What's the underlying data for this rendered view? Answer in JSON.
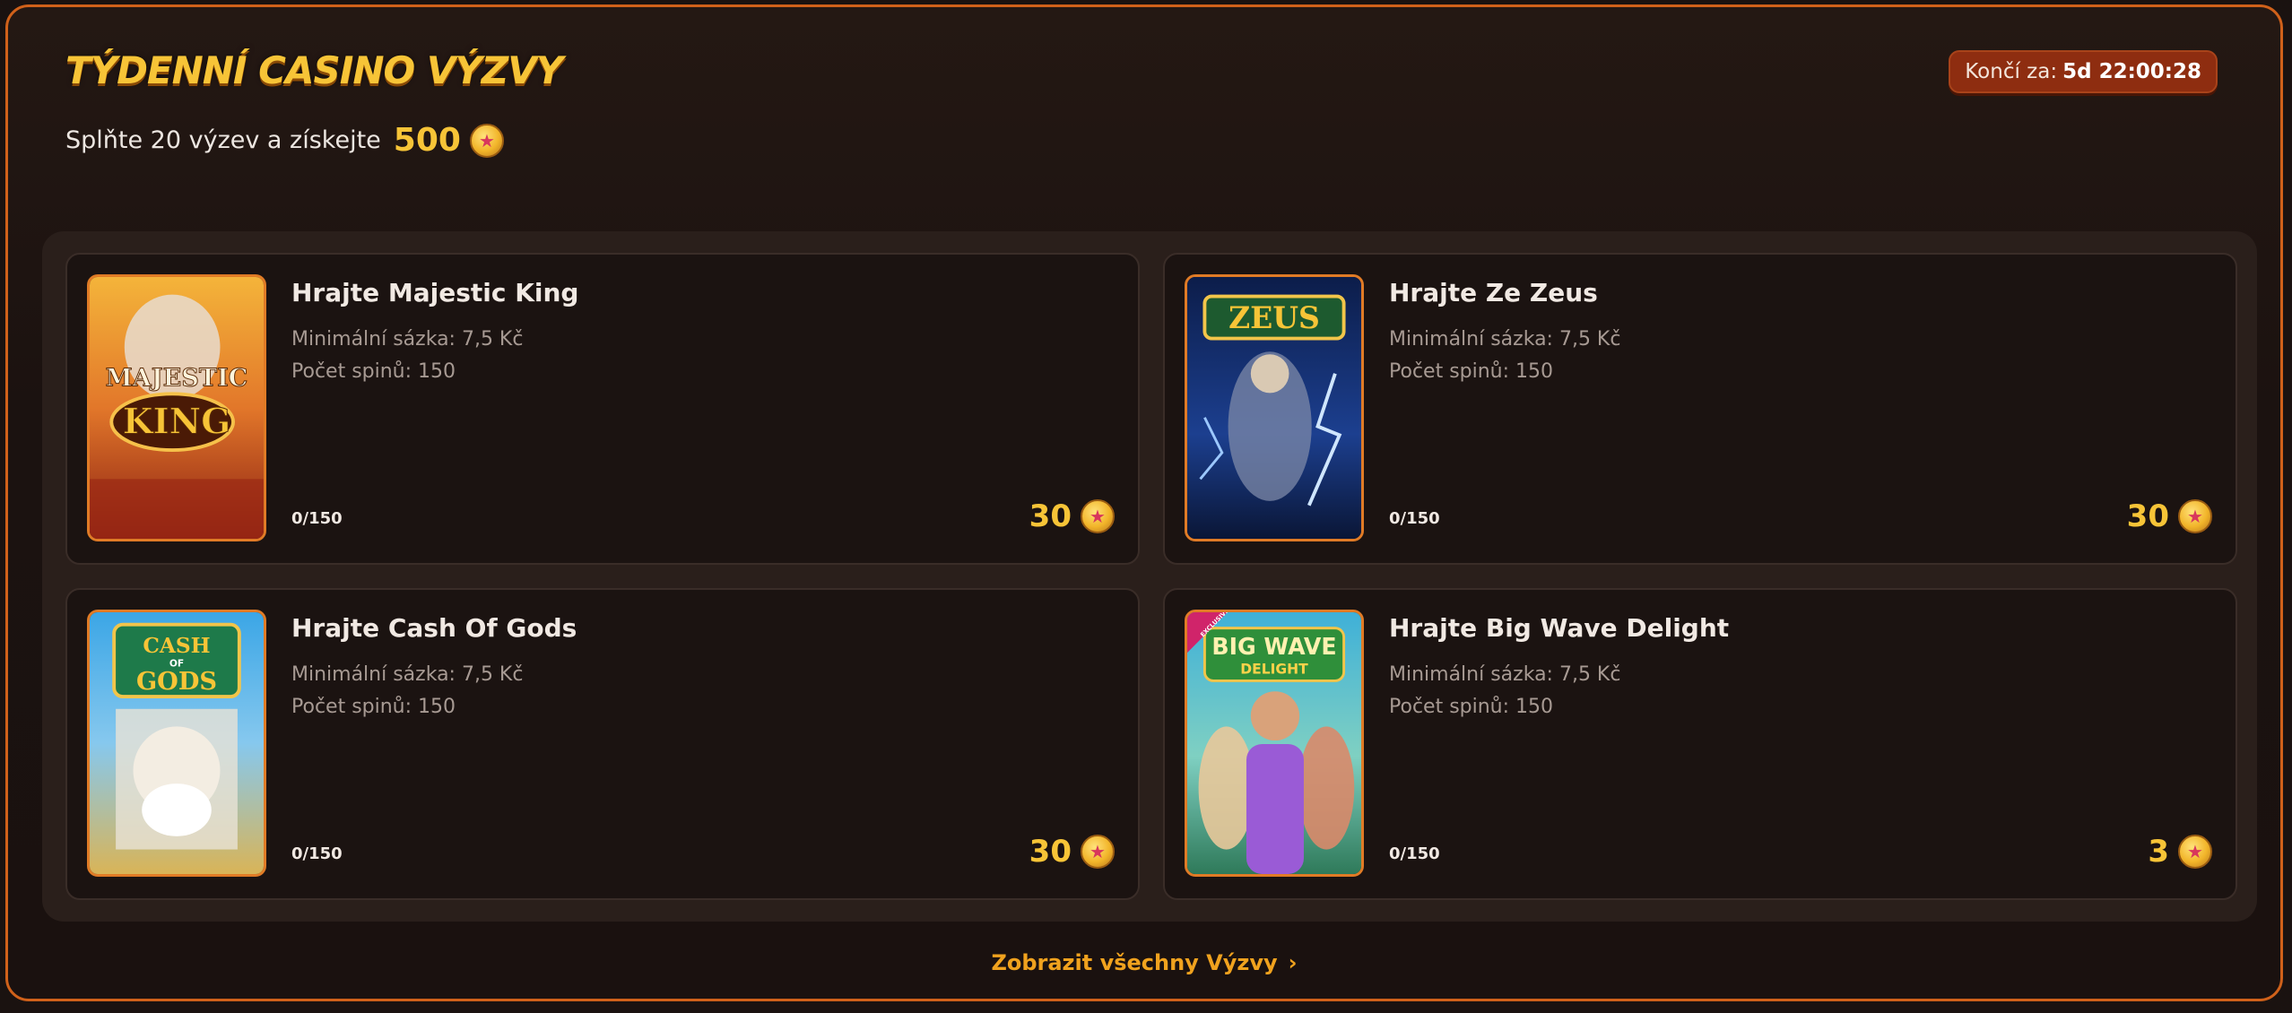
{
  "title": "TÝDENNÍ CASINO VÝZVY",
  "subtitle": {
    "text": "Splňte 20 výzev a získejte",
    "amount": "500"
  },
  "timer": {
    "label": "Končí za:",
    "value": "5d 22:00:28"
  },
  "challenges": [
    {
      "title": "Hrajte Majestic King",
      "min_bet": "Minimální sázka: 7,5 Kč",
      "spins": "Počet spinů: 150",
      "progress": "0/150",
      "reward": "30",
      "thumb_text": [
        "MAJESTIC",
        "KING"
      ]
    },
    {
      "title": "Hrajte Ze Zeus",
      "min_bet": "Minimální sázka: 7,5 Kč",
      "spins": "Počet spinů: 150",
      "progress": "0/150",
      "reward": "30",
      "thumb_text": [
        "ZEUS"
      ]
    },
    {
      "title": "Hrajte Cash Of Gods",
      "min_bet": "Minimální sázka: 7,5 Kč",
      "spins": "Počet spinů: 150",
      "progress": "0/150",
      "reward": "30",
      "thumb_text": [
        "CASH",
        "OF",
        "GODS"
      ]
    },
    {
      "title": "Hrajte Big Wave Delight",
      "min_bet": "Minimální sázka: 7,5 Kč",
      "spins": "Počet spinů: 150",
      "progress": "0/150",
      "reward": "3",
      "thumb_text": [
        "BIG WAVE",
        "DELIGHT",
        "EXCLUSIVE"
      ]
    }
  ],
  "footer": {
    "link_label": "Zobrazit všechny Výzvy"
  },
  "colors": {
    "accent": "#f7c437",
    "border": "#d0611a",
    "timer_bg": "#8e2d10",
    "card_bg": "#1b1311"
  },
  "icons": {
    "coin": "star-coin-icon",
    "chevron": "chevron-right-icon"
  }
}
